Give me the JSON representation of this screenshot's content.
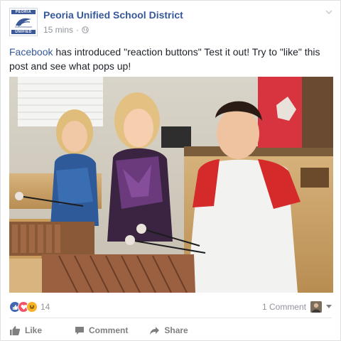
{
  "post": {
    "page_name": "Peoria Unified School District",
    "timestamp": "15 mins",
    "separator": "·",
    "avatar": {
      "top_text": "PEORIA",
      "bottom_text": "UNIFIED"
    },
    "text_link": "Facebook",
    "text_body": " has introduced \"reaction buttons\" Test it out! Try to \"like\" this post and see what pops up!",
    "image_alt": "Children smiling while playing xylophones in a music class"
  },
  "reactions": {
    "icons": [
      "like-icon",
      "love-icon",
      "haha-icon"
    ],
    "count": "14"
  },
  "comments": {
    "summary": "1 Comment"
  },
  "actions": {
    "like_label": "Like",
    "comment_label": "Comment",
    "share_label": "Share"
  },
  "colors": {
    "link": "#365899",
    "like": "#4267b2",
    "love": "#f25268",
    "haha": "#f7b125",
    "muted": "#90949c",
    "action": "#7f7f7f"
  }
}
